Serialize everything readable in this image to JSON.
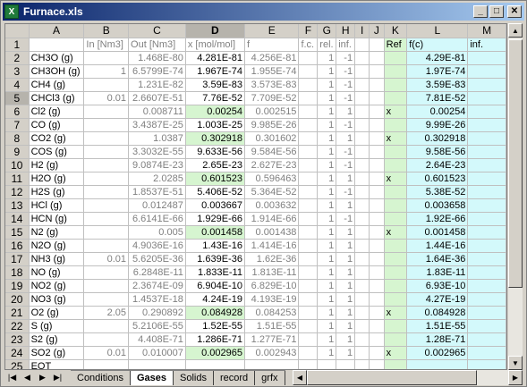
{
  "window": {
    "title": "Furnace.xls",
    "app_icon_glyph": "X",
    "minimize": "_",
    "maximize": "□",
    "close": "✕"
  },
  "columns": [
    "A",
    "B",
    "C",
    "D",
    "E",
    "F",
    "G",
    "H",
    "I",
    "J",
    "K",
    "L",
    "M"
  ],
  "header_row": {
    "num": "1",
    "A": "",
    "B": "In [Nm3]",
    "C": "Out [Nm3]",
    "D": "x [mol/mol]",
    "E": "f",
    "F": "f.c.",
    "G": "rel.",
    "H": "inf.",
    "I": "",
    "J": "",
    "K": "Ref",
    "L": "f(c)",
    "M": "inf."
  },
  "rows": [
    {
      "num": "2",
      "A": "CH3O (g)",
      "B": "",
      "C": "1.468E-80",
      "D": "4.281E-81",
      "E": "4.256E-81",
      "F": "",
      "G": "1",
      "H": "-1",
      "K": "",
      "L": "4.29E-81"
    },
    {
      "num": "3",
      "A": "CH3OH (g)",
      "B": "1",
      "C": "6.5799E-74",
      "D": "1.967E-74",
      "E": "1.955E-74",
      "F": "",
      "G": "1",
      "H": "-1",
      "K": "",
      "L": "1.97E-74"
    },
    {
      "num": "4",
      "A": "CH4 (g)",
      "B": "",
      "C": "1.231E-82",
      "D": "3.59E-83",
      "E": "3.573E-83",
      "F": "",
      "G": "1",
      "H": "-1",
      "K": "",
      "L": "3.59E-83"
    },
    {
      "num": "5",
      "A": "CHCl3 (g)",
      "B": "0.01",
      "C": "2.6607E-51",
      "D": "7.76E-52",
      "E": "7.709E-52",
      "F": "",
      "G": "1",
      "H": "-1",
      "K": "",
      "L": "7.81E-52"
    },
    {
      "num": "6",
      "A": "Cl2 (g)",
      "B": "",
      "C": "0.008711",
      "D": "0.00254",
      "E": "0.002515",
      "F": "",
      "G": "1",
      "H": "1",
      "K": "x",
      "L": "0.00254"
    },
    {
      "num": "7",
      "A": "CO (g)",
      "B": "",
      "C": "3.4387E-25",
      "D": "1.003E-25",
      "E": "9.985E-26",
      "F": "",
      "G": "1",
      "H": "-1",
      "K": "",
      "L": "9.99E-26"
    },
    {
      "num": "8",
      "A": "CO2 (g)",
      "B": "",
      "C": "1.0387",
      "D": "0.302918",
      "E": "0.301602",
      "F": "",
      "G": "1",
      "H": "1",
      "K": "x",
      "L": "0.302918"
    },
    {
      "num": "9",
      "A": "COS (g)",
      "B": "",
      "C": "3.3032E-55",
      "D": "9.633E-56",
      "E": "9.584E-56",
      "F": "",
      "G": "1",
      "H": "-1",
      "K": "",
      "L": "9.58E-56"
    },
    {
      "num": "10",
      "A": "H2 (g)",
      "B": "",
      "C": "9.0874E-23",
      "D": "2.65E-23",
      "E": "2.627E-23",
      "F": "",
      "G": "1",
      "H": "-1",
      "K": "",
      "L": "2.64E-23"
    },
    {
      "num": "11",
      "A": "H2O (g)",
      "B": "",
      "C": "2.0285",
      "D": "0.601523",
      "E": "0.596463",
      "F": "",
      "G": "1",
      "H": "1",
      "K": "x",
      "L": "0.601523"
    },
    {
      "num": "12",
      "A": "H2S (g)",
      "B": "",
      "C": "1.8537E-51",
      "D": "5.406E-52",
      "E": "5.364E-52",
      "F": "",
      "G": "1",
      "H": "-1",
      "K": "",
      "L": "5.38E-52"
    },
    {
      "num": "13",
      "A": "HCl (g)",
      "B": "",
      "C": "0.012487",
      "D": "0.003667",
      "E": "0.003632",
      "F": "",
      "G": "1",
      "H": "1",
      "K": "",
      "L": "0.003658"
    },
    {
      "num": "14",
      "A": "HCN (g)",
      "B": "",
      "C": "6.6141E-66",
      "D": "1.929E-66",
      "E": "1.914E-66",
      "F": "",
      "G": "1",
      "H": "-1",
      "K": "",
      "L": "1.92E-66"
    },
    {
      "num": "15",
      "A": "N2 (g)",
      "B": "",
      "C": "0.005",
      "D": "0.001458",
      "E": "0.001438",
      "F": "",
      "G": "1",
      "H": "1",
      "K": "x",
      "L": "0.001458"
    },
    {
      "num": "16",
      "A": "N2O (g)",
      "B": "",
      "C": "4.9036E-16",
      "D": "1.43E-16",
      "E": "1.414E-16",
      "F": "",
      "G": "1",
      "H": "1",
      "K": "",
      "L": "1.44E-16"
    },
    {
      "num": "17",
      "A": "NH3 (g)",
      "B": "0.01",
      "C": "5.6205E-36",
      "D": "1.639E-36",
      "E": "1.62E-36",
      "F": "",
      "G": "1",
      "H": "1",
      "K": "",
      "L": "1.64E-36"
    },
    {
      "num": "18",
      "A": "NO (g)",
      "B": "",
      "C": "6.2848E-11",
      "D": "1.833E-11",
      "E": "1.813E-11",
      "F": "",
      "G": "1",
      "H": "1",
      "K": "",
      "L": "1.83E-11"
    },
    {
      "num": "19",
      "A": "NO2 (g)",
      "B": "",
      "C": "2.3674E-09",
      "D": "6.904E-10",
      "E": "6.829E-10",
      "F": "",
      "G": "1",
      "H": "1",
      "K": "",
      "L": "6.93E-10"
    },
    {
      "num": "20",
      "A": "NO3 (g)",
      "B": "",
      "C": "1.4537E-18",
      "D": "4.24E-19",
      "E": "4.193E-19",
      "F": "",
      "G": "1",
      "H": "1",
      "K": "",
      "L": "4.27E-19"
    },
    {
      "num": "21",
      "A": "O2 (g)",
      "B": "2.05",
      "C": "0.290892",
      "D": "0.084928",
      "E": "0.084253",
      "F": "",
      "G": "1",
      "H": "1",
      "K": "x",
      "L": "0.084928"
    },
    {
      "num": "22",
      "A": "S (g)",
      "B": "",
      "C": "5.2106E-55",
      "D": "1.52E-55",
      "E": "1.51E-55",
      "F": "",
      "G": "1",
      "H": "1",
      "K": "",
      "L": "1.51E-55"
    },
    {
      "num": "23",
      "A": "S2 (g)",
      "B": "",
      "C": "4.408E-71",
      "D": "1.286E-71",
      "E": "1.277E-71",
      "F": "",
      "G": "1",
      "H": "1",
      "K": "",
      "L": "1.28E-71"
    },
    {
      "num": "24",
      "A": "SO2 (g)",
      "B": "0.01",
      "C": "0.010007",
      "D": "0.002965",
      "E": "0.002943",
      "F": "",
      "G": "1",
      "H": "1",
      "K": "x",
      "L": "0.002965"
    },
    {
      "num": "25",
      "A": "EOT",
      "B": "",
      "C": "",
      "D": "",
      "E": "",
      "F": "",
      "G": "",
      "H": "",
      "K": "",
      "L": ""
    }
  ],
  "bold_D_rows": [
    "6",
    "8",
    "11",
    "15",
    "21",
    "24"
  ],
  "selected_row": "5",
  "selected_col": "D",
  "sheet_tabs": [
    "Conditions",
    "Gases",
    "Solids",
    "record",
    "grfx"
  ],
  "active_tab": "Gases",
  "nav_glyphs": [
    "|◀",
    "◀",
    "▶",
    "▶|"
  ],
  "scroll_glyphs": {
    "up": "▲",
    "down": "▼",
    "left": "◀",
    "right": "▶"
  },
  "colors": {
    "green_fill": "#d6f5d0",
    "cyan_fill": "#d3f9fb",
    "titlebar": "#0a246a"
  }
}
